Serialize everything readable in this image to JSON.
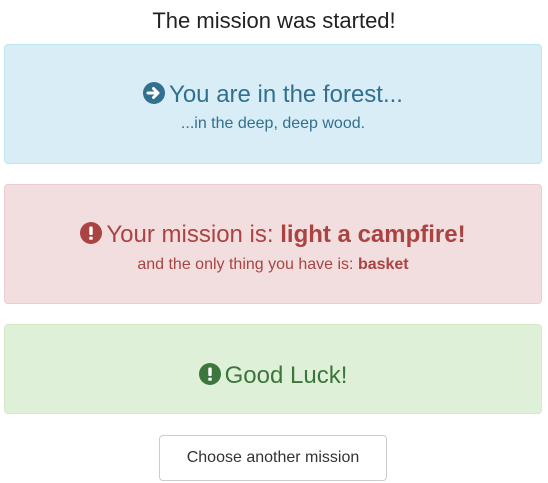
{
  "page": {
    "title": "The mission was started!"
  },
  "location_alert": {
    "icon": "arrow-circle-right-icon",
    "heading": "You are in the forest...",
    "subtext": "...in the deep, deep wood.",
    "color": "#31708f",
    "background": "#d9edf7"
  },
  "mission_alert": {
    "icon": "exclamation-circle-icon",
    "heading_prefix": "Your mission is: ",
    "mission": "light a campfire!",
    "subtext_prefix": "and the only thing you have is: ",
    "item": "basket",
    "color": "#a94442",
    "background": "#f2dede"
  },
  "luck_alert": {
    "icon": "exclamation-circle-icon",
    "heading": "Good Luck!",
    "color": "#3c763d",
    "background": "#dff0d8"
  },
  "actions": {
    "choose_another_label": "Choose another mission"
  }
}
